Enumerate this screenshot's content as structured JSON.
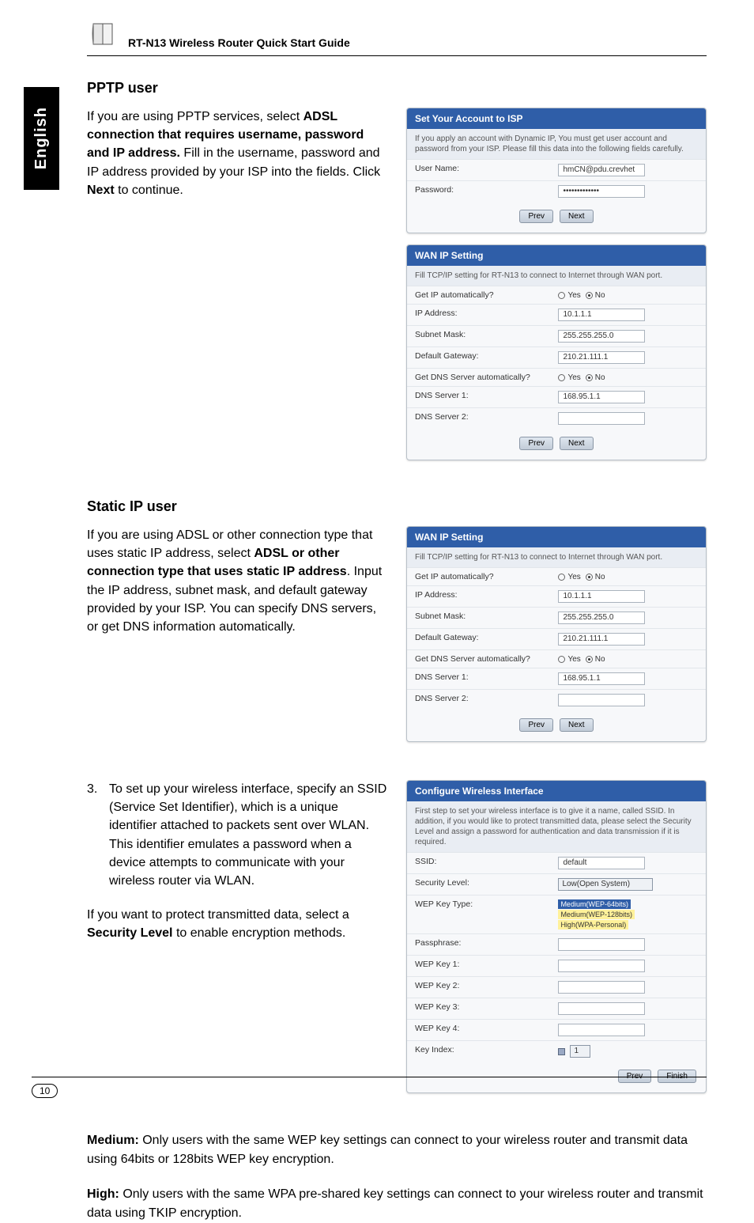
{
  "header": {
    "title": "RT-N13 Wireless Router Quick Start Guide"
  },
  "sidetab": {
    "label": "English"
  },
  "pptp": {
    "heading": "PPTP user",
    "body_prefix": "If you are using PPTP services, select ",
    "body_bold1": "ADSL connection that requires username, password and IP address.",
    "body_mid": " Fill in the username, password and IP address provided by your ISP into the fields. Click ",
    "body_bold2": "Next",
    "body_suffix": " to continue."
  },
  "fig_account": {
    "title": "Set Your Account to ISP",
    "subtext": "If you apply an account with Dynamic IP, You must get user account and password from your ISP. Please fill this data into the following fields carefully.",
    "rows": {
      "username_label": "User Name:",
      "username_value": "hmCN@pdu.crevhet",
      "password_label": "Password:",
      "password_value": "•••••••••••••"
    },
    "btn_prev": "Prev",
    "btn_next": "Next"
  },
  "fig_wan1": {
    "title": "WAN IP Setting",
    "subtext": "Fill TCP/IP setting for RT-N13 to connect to Internet through WAN port.",
    "rows": {
      "getip_label": "Get IP automatically?",
      "yes": "Yes",
      "no": "No",
      "ipaddr_label": "IP Address:",
      "ipaddr_value": "10.1.1.1",
      "subnet_label": "Subnet Mask:",
      "subnet_value": "255.255.255.0",
      "gateway_label": "Default Gateway:",
      "gateway_value": "210.21.111.1",
      "getdns_label": "Get DNS Server automatically?",
      "dns1_label": "DNS Server 1:",
      "dns1_value": "168.95.1.1",
      "dns2_label": "DNS Server 2:"
    },
    "btn_prev": "Prev",
    "btn_next": "Next"
  },
  "staticip": {
    "heading": "Static IP user",
    "body_prefix": "If you are using ADSL or other connection type that uses static IP address, select ",
    "body_bold": "ADSL or other connection type that uses static IP address",
    "body_suffix": ". Input the IP address, subnet mask, and default gateway provided by your ISP. You can specify DNS servers, or get DNS information automatically."
  },
  "fig_wan2": {
    "title": "WAN IP Setting",
    "subtext": "Fill TCP/IP setting for RT-N13 to connect to Internet through WAN port.",
    "rows": {
      "getip_label": "Get IP automatically?",
      "yes": "Yes",
      "no": "No",
      "ipaddr_label": "IP Address:",
      "ipaddr_value": "10.1.1.1",
      "subnet_label": "Subnet Mask:",
      "subnet_value": "255.255.255.0",
      "gateway_label": "Default Gateway:",
      "gateway_value": "210.21.111.1",
      "getdns_label": "Get DNS Server automatically?",
      "dns1_label": "DNS Server 1:",
      "dns1_value": "168.95.1.1",
      "dns2_label": "DNS Server 2:"
    },
    "btn_prev": "Prev",
    "btn_next": "Next"
  },
  "step3": {
    "num": "3.",
    "text": "To set up your wireless interface, specify an SSID (Service Set Identifier), which is a unique identifier attached to packets sent over WLAN. This identifier emulates a password when a device attempts to communicate with your wireless router via WLAN."
  },
  "protect": {
    "prefix": "If you want to protect transmitted data, select a ",
    "bold": "Security Level",
    "suffix": " to enable encryption methods."
  },
  "fig_wifi": {
    "title": "Configure Wireless Interface",
    "subtext": "First step to set your wireless interface is to give it a name, called SSID. In addition, if you would like to protect transmitted data, please select the Security Level and assign a password for authentication and data transmission if it is required.",
    "rows": {
      "ssid_label": "SSID:",
      "ssid_value": "default",
      "seclvl_label": "Security Level:",
      "seclvl_value": "Low(Open System)",
      "keytype_label": "WEP Key Type:",
      "opt_med": "Medium(WEP-64bits)",
      "opt_med2": "Medium(WEP-128bits)",
      "opt_high": "High(WPA-Personal)",
      "pass_label": "Passphrase:",
      "k1_label": "WEP Key 1:",
      "k2_label": "WEP Key 2:",
      "k3_label": "WEP Key 3:",
      "k4_label": "WEP Key 4:",
      "keyidx_label": "Key Index:",
      "keyidx_value": "1"
    },
    "btn_prev": "Prev",
    "btn_finish": "Finish"
  },
  "medium": {
    "bold": "Medium:",
    "text": " Only users with the same WEP key settings can connect to your wireless router and transmit data using 64bits or 128bits WEP key encryption."
  },
  "high": {
    "bold": "High:",
    "text": " Only users with the same WPA pre-shared key settings can connect to your wireless router and transmit data using TKIP encryption."
  },
  "footer": {
    "page": "10"
  }
}
